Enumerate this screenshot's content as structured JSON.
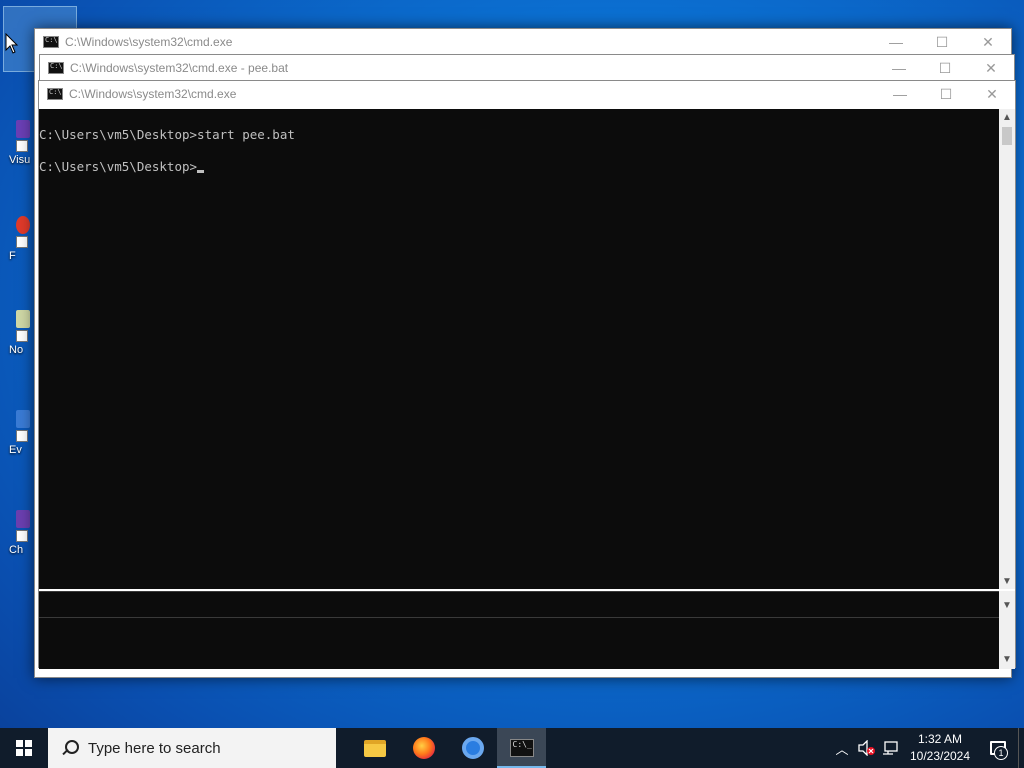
{
  "desktop": {
    "icons": [
      {
        "label": "Visu",
        "color": "#6a3fb5"
      },
      {
        "label": "F",
        "color": "#e03a2a"
      },
      {
        "label": "No",
        "color": "#cfd8a6"
      },
      {
        "label": "Ev",
        "color": "#3a7bd5"
      },
      {
        "label": "Ch",
        "color": "#6b3fb0"
      }
    ]
  },
  "windows": {
    "back": {
      "title": "C:\\Windows\\system32\\cmd.exe"
    },
    "middle": {
      "title": "C:\\Windows\\system32\\cmd.exe - pee.bat"
    },
    "front": {
      "title": "C:\\Windows\\system32\\cmd.exe",
      "console_lines": [
        "C:\\Users\\vm5\\Desktop>start pee.bat",
        "C:\\Users\\vm5\\Desktop>"
      ]
    },
    "controls": {
      "minimize": "—",
      "maximize": "☐",
      "close": "✕"
    }
  },
  "taskbar": {
    "search_placeholder": "Type here to search",
    "apps": [
      "file-explorer",
      "firefox",
      "chrome",
      "command-prompt"
    ],
    "time": "1:32 AM",
    "date": "10/23/2024",
    "notification_count": "1"
  }
}
